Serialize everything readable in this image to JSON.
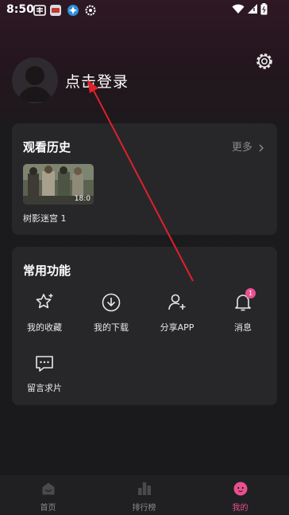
{
  "status_bar": {
    "time": "8:50"
  },
  "profile": {
    "login_label": "点击登录"
  },
  "history": {
    "title": "观看历史",
    "more_label": "更多",
    "items": [
      {
        "title": "树影迷宫 1",
        "duration": "18:0"
      }
    ]
  },
  "functions": {
    "title": "常用功能",
    "items": [
      {
        "label": "我的收藏",
        "icon": "star-icon"
      },
      {
        "label": "我的下载",
        "icon": "download-icon"
      },
      {
        "label": "分享APP",
        "icon": "share-user-icon"
      },
      {
        "label": "消息",
        "icon": "bell-icon",
        "badge": "1"
      },
      {
        "label": "留言求片",
        "icon": "message-icon"
      }
    ]
  },
  "tabbar": {
    "items": [
      {
        "label": "首页",
        "icon": "home-icon"
      },
      {
        "label": "排行榜",
        "icon": "ranking-icon"
      },
      {
        "label": "我的",
        "icon": "profile-face-icon"
      }
    ],
    "active_color": "#e8508f"
  },
  "colors": {
    "accent": "#e8508f",
    "annotation_arrow": "#e0202a"
  }
}
